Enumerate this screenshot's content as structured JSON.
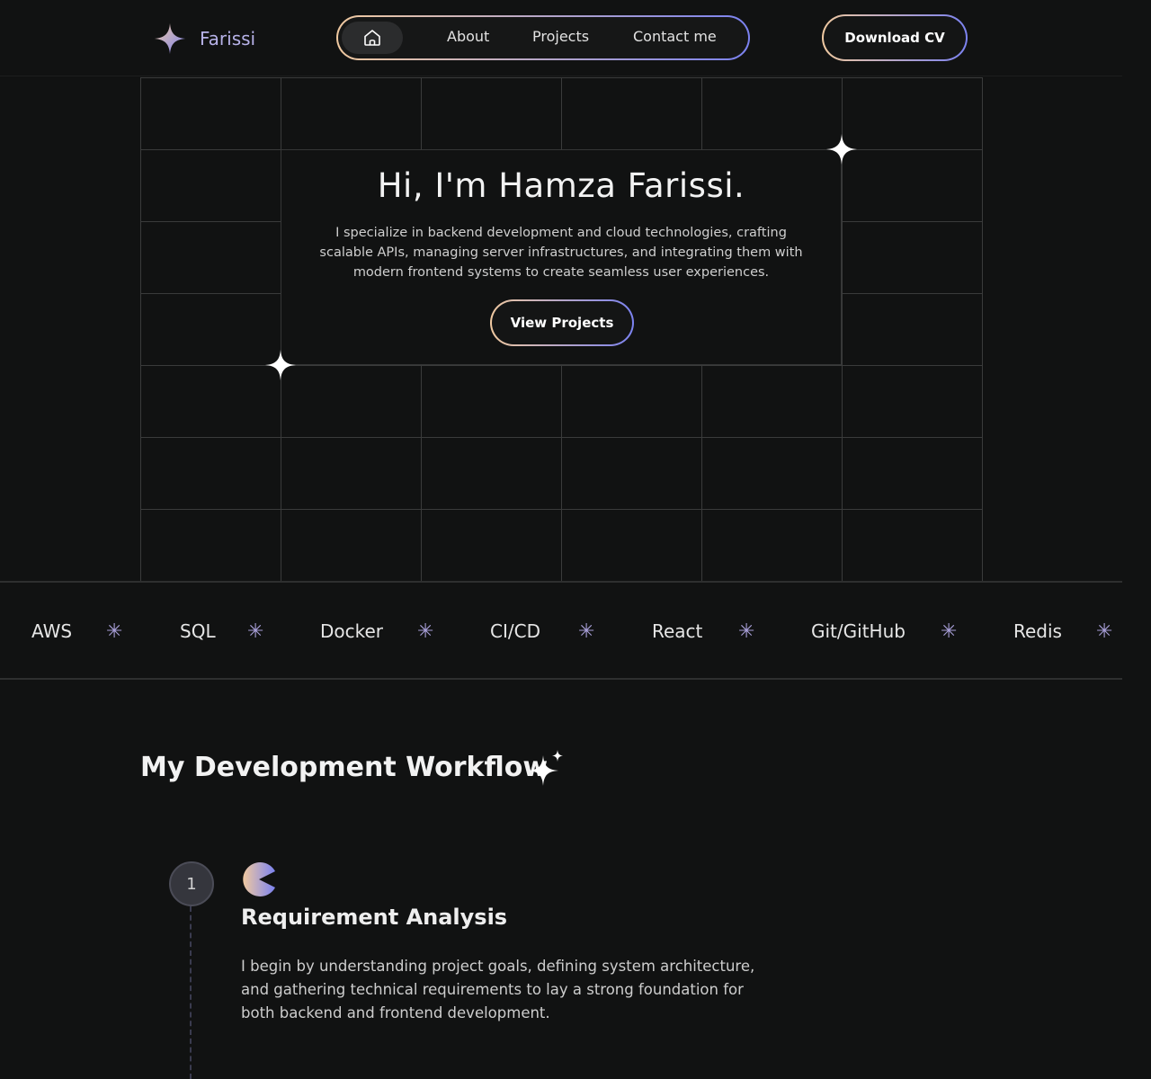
{
  "header": {
    "brand": "Farissi",
    "nav": {
      "about": "About",
      "projects": "Projects",
      "contact": "Contact me"
    },
    "cv_button": "Download CV"
  },
  "hero": {
    "title": "Hi, I'm Hamza Farissi.",
    "subtitle": "I specialize in backend development and cloud technologies, crafting scalable APIs, managing server infrastructures, and integrating them with modern frontend systems to create seamless user experiences.",
    "cta": "View Projects"
  },
  "tech_stack": [
    "AWS",
    "SQL",
    "Docker",
    "CI/CD",
    "React",
    "Git/GitHub",
    "Redis"
  ],
  "workflow": {
    "title": "My Development Workflow",
    "steps": [
      {
        "number": "1",
        "title": "Requirement Analysis",
        "description": "I begin by understanding project goals, defining system architecture, and gathering technical requirements to lay a strong foundation for both backend and frontend development."
      }
    ]
  },
  "colors": {
    "gradient_start": "#f0c9a0",
    "gradient_end": "#7b82f0",
    "background": "#111212"
  }
}
